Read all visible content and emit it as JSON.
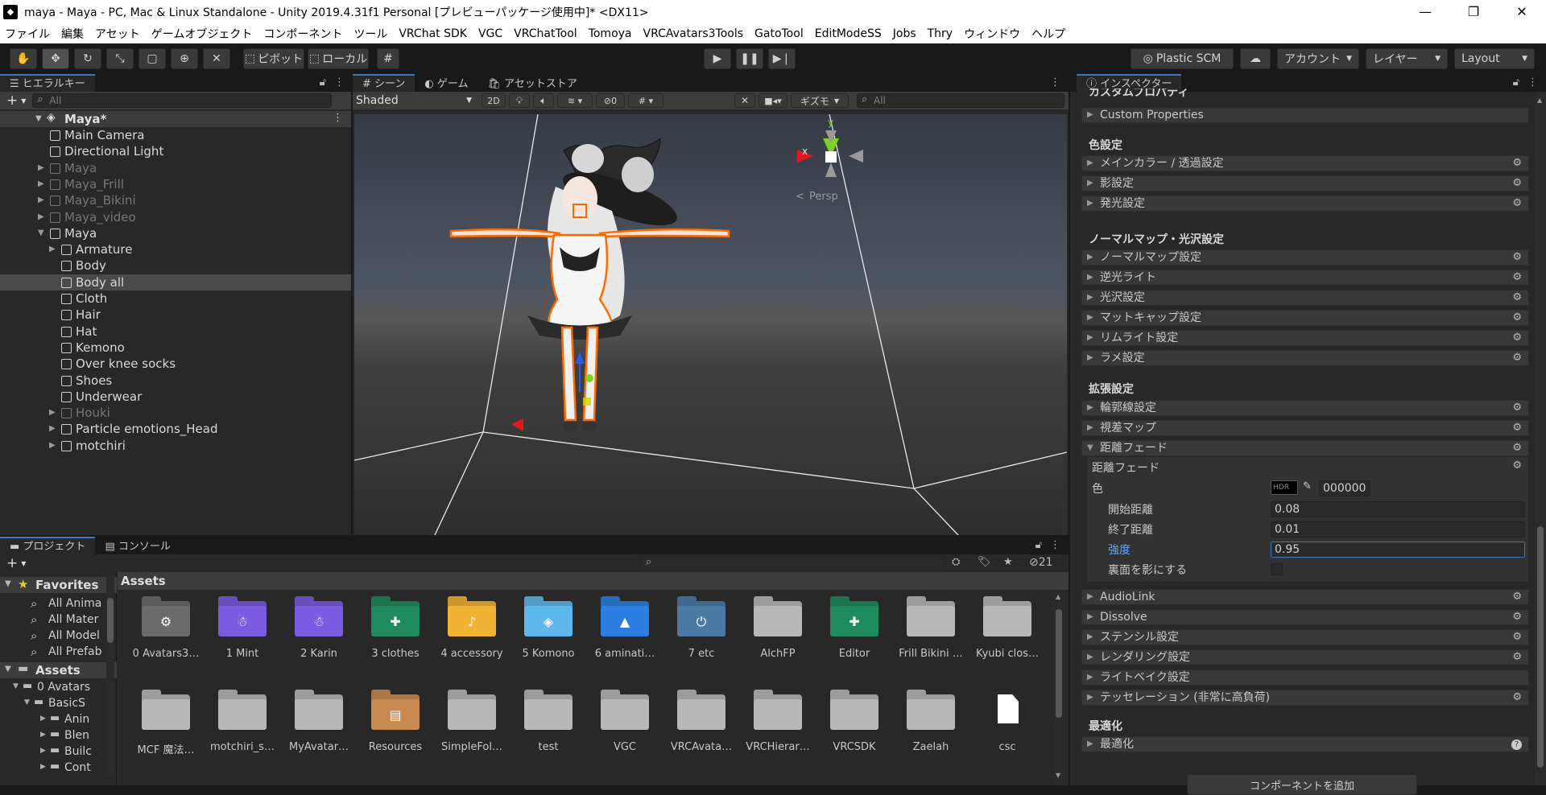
{
  "window": {
    "title": "maya - Maya - PC, Mac & Linux Standalone - Unity 2019.4.31f1 Personal [プレビューパッケージ使用中]* <DX11>",
    "minimize": "—",
    "maximize": "❐",
    "close": "✕"
  },
  "menu": [
    "ファイル",
    "編集",
    "アセット",
    "ゲームオブジェクト",
    "コンポーネント",
    "ツール",
    "VRChat SDK",
    "VGC",
    "VRChatTool",
    "Tomoya",
    "VRCAvatars3Tools",
    "GatoTool",
    "EditModeSS",
    "Jobs",
    "Thry",
    "ウィンドウ",
    "ヘルプ"
  ],
  "toolbar": {
    "pivot": "ピボット",
    "local": "ローカル",
    "plastic": "Plastic SCM",
    "account": "アカウント",
    "layers": "レイヤー",
    "layout": "Layout"
  },
  "hierarchy": {
    "tab": "ヒエラルキー",
    "search_placeholder": "All",
    "scene": "Maya*",
    "items": [
      {
        "label": "Main Camera",
        "indent": 1,
        "arrow": "",
        "dim": false,
        "sel": false
      },
      {
        "label": "Directional Light",
        "indent": 1,
        "arrow": "",
        "dim": false,
        "sel": false
      },
      {
        "label": "Maya",
        "indent": 1,
        "arrow": "▶",
        "dim": true,
        "sel": false
      },
      {
        "label": "Maya_Frill",
        "indent": 1,
        "arrow": "▶",
        "dim": true,
        "sel": false
      },
      {
        "label": "Maya_Bikini",
        "indent": 1,
        "arrow": "▶",
        "dim": true,
        "sel": false
      },
      {
        "label": "Maya_video",
        "indent": 1,
        "arrow": "▶",
        "dim": true,
        "sel": false
      },
      {
        "label": "Maya",
        "indent": 1,
        "arrow": "▼",
        "dim": false,
        "sel": false
      },
      {
        "label": "Armature",
        "indent": 2,
        "arrow": "▶",
        "dim": false,
        "sel": false
      },
      {
        "label": "Body",
        "indent": 2,
        "arrow": "",
        "dim": false,
        "sel": false
      },
      {
        "label": "Body all",
        "indent": 2,
        "arrow": "",
        "dim": false,
        "sel": true
      },
      {
        "label": "Cloth",
        "indent": 2,
        "arrow": "",
        "dim": false,
        "sel": false
      },
      {
        "label": "Hair",
        "indent": 2,
        "arrow": "",
        "dim": false,
        "sel": false
      },
      {
        "label": "Hat",
        "indent": 2,
        "arrow": "",
        "dim": false,
        "sel": false
      },
      {
        "label": "Kemono",
        "indent": 2,
        "arrow": "",
        "dim": false,
        "sel": false
      },
      {
        "label": "Over knee socks",
        "indent": 2,
        "arrow": "",
        "dim": false,
        "sel": false
      },
      {
        "label": "Shoes",
        "indent": 2,
        "arrow": "",
        "dim": false,
        "sel": false
      },
      {
        "label": "Underwear",
        "indent": 2,
        "arrow": "",
        "dim": false,
        "sel": false
      },
      {
        "label": "Houki",
        "indent": 2,
        "arrow": "▶",
        "dim": true,
        "sel": false
      },
      {
        "label": "Particle emotions_Head",
        "indent": 2,
        "arrow": "▶",
        "dim": false,
        "sel": false
      },
      {
        "label": "motchiri",
        "indent": 2,
        "arrow": "▶",
        "dim": false,
        "sel": false
      }
    ]
  },
  "scene": {
    "tabs": [
      "シーン",
      "ゲーム",
      "アセットストア"
    ],
    "shading": "Shaded",
    "mode2d": "2D",
    "hidden_count": "0",
    "gizmos": "ギズモ",
    "search_placeholder": "All",
    "persp": "Persp",
    "axis_y": "y",
    "axis_x": "x"
  },
  "inspector": {
    "tab": "インスペクター",
    "clipped_header": "カスタムプロパティ",
    "custom_properties": "Custom Properties",
    "sections": [
      {
        "head": "色設定",
        "rows": [
          "メインカラー / 透過設定",
          "影設定",
          "発光設定"
        ]
      },
      {
        "head": "ノーマルマップ・光沢設定",
        "rows": [
          "ノーマルマップ設定",
          "逆光ライト",
          "光沢設定",
          "マットキャップ設定",
          "リムライト設定",
          "ラメ設定"
        ]
      },
      {
        "head": "拡張設定",
        "rows": [
          "輪郭線設定",
          "視差マップ",
          "距離フェード"
        ]
      }
    ],
    "fade_box": {
      "title": "距離フェード",
      "color_label": "色",
      "hdr": "HDR",
      "color_hex": "000000",
      "start_label": "開始距離",
      "start_val": "0.08",
      "end_label": "終了距離",
      "end_val": "0.01",
      "strength_label": "強度",
      "strength_val": "0.95",
      "backface_label": "裏面を影にする"
    },
    "more_rows": [
      "AudioLink",
      "Dissolve",
      "ステンシル設定",
      "レンダリング設定",
      "ライトベイク設定",
      "テッセレーション (非常に高負荷)"
    ],
    "optimize_head": "最適化",
    "optimize_row": "最適化",
    "add_component": "コンポーネントを追加"
  },
  "project": {
    "tabs": [
      "プロジェクト",
      "コンソール"
    ],
    "hidden_count": "21",
    "favorites": "Favorites",
    "fav_items": [
      "All Anima",
      "All Mater",
      "All Model",
      "All Prefab"
    ],
    "assets_root": "Assets",
    "tree": [
      "0 Avatars",
      "BasicS",
      "Anin",
      "Blen",
      "Builc",
      "Cont"
    ],
    "breadcrumb": "Assets",
    "row1": [
      {
        "label": "0 Avatars3…",
        "color": "#6b6b6b",
        "sym": "⚙"
      },
      {
        "label": "1 Mint",
        "color": "#7a5ce0",
        "sym": "☃"
      },
      {
        "label": "2 Karin",
        "color": "#7a5ce0",
        "sym": "☃"
      },
      {
        "label": "3 clothes",
        "color": "#1f8a5e",
        "sym": "✚"
      },
      {
        "label": "4 accessory",
        "color": "#f2b233",
        "sym": "♪"
      },
      {
        "label": "5 Komono",
        "color": "#5fb8ec",
        "sym": "◈"
      },
      {
        "label": "6 aminati…",
        "color": "#2c7fe0",
        "sym": "▲"
      },
      {
        "label": "7 etc",
        "color": "#4c7aa6",
        "sym": "⏻"
      },
      {
        "label": "AlchFP",
        "color": "#b8b8b8",
        "sym": ""
      },
      {
        "label": "Editor",
        "color": "#1f8a5e",
        "sym": "✚"
      },
      {
        "label": "Frill Bikini …",
        "color": "#b8b8b8",
        "sym": ""
      },
      {
        "label": "Kyubi clos…",
        "color": "#b8b8b8",
        "sym": ""
      }
    ],
    "row2": [
      {
        "label": "MCF 魔法…",
        "color": "#b8b8b8",
        "sym": ""
      },
      {
        "label": "motchiri_s…",
        "color": "#b8b8b8",
        "sym": ""
      },
      {
        "label": "MyAvatar…",
        "color": "#b8b8b8",
        "sym": ""
      },
      {
        "label": "Resources",
        "color": "#c98a52",
        "sym": "▤"
      },
      {
        "label": "SimpleFol…",
        "color": "#b8b8b8",
        "sym": ""
      },
      {
        "label": "test",
        "color": "#b8b8b8",
        "sym": ""
      },
      {
        "label": "VGC",
        "color": "#b8b8b8",
        "sym": ""
      },
      {
        "label": "VRCAvata…",
        "color": "#b8b8b8",
        "sym": ""
      },
      {
        "label": "VRCHierar…",
        "color": "#b8b8b8",
        "sym": ""
      },
      {
        "label": "VRCSDK",
        "color": "#b8b8b8",
        "sym": ""
      },
      {
        "label": "Zaelah",
        "color": "#b8b8b8",
        "sym": ""
      },
      {
        "label": "csc",
        "color": "#ffffff",
        "sym": "file"
      }
    ]
  }
}
